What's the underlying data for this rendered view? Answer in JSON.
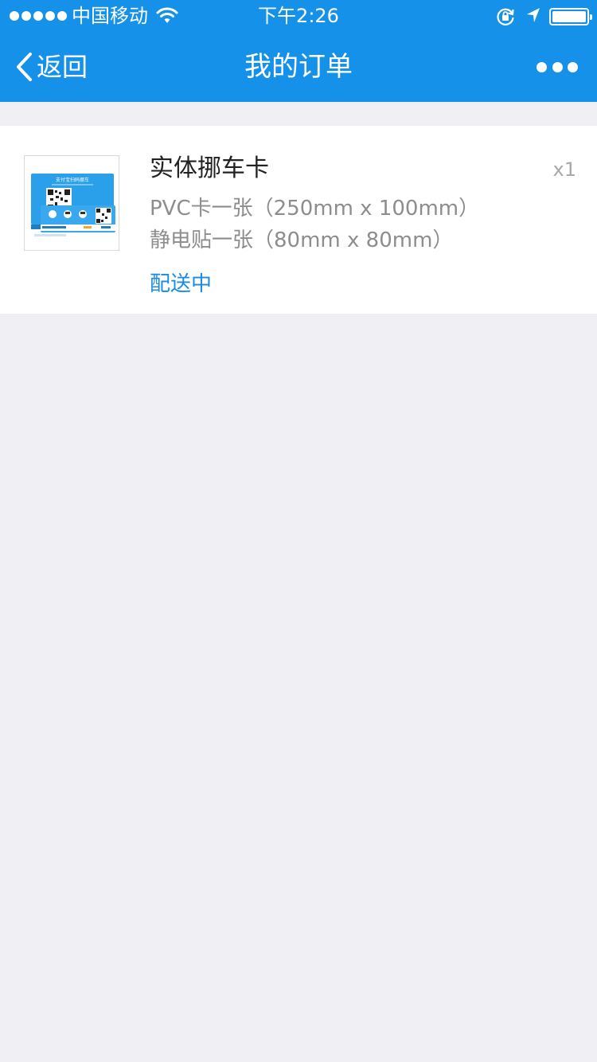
{
  "status_bar": {
    "carrier": "中国移动",
    "time": "下午2:26"
  },
  "nav": {
    "back_label": "返回",
    "title": "我的订单"
  },
  "order": {
    "product_name": "实体挪车卡",
    "quantity": "x1",
    "spec_lines": [
      "PVC卡一张（250mm x 100mm）",
      "静电贴一张（80mm x 80mm）"
    ],
    "status": "配送中",
    "thumbnail_card_title": "支付宝扫码挪车"
  },
  "colors": {
    "header_bg": "#1591ea",
    "page_bg": "#efeff4",
    "status_text": "#1a8be1"
  }
}
